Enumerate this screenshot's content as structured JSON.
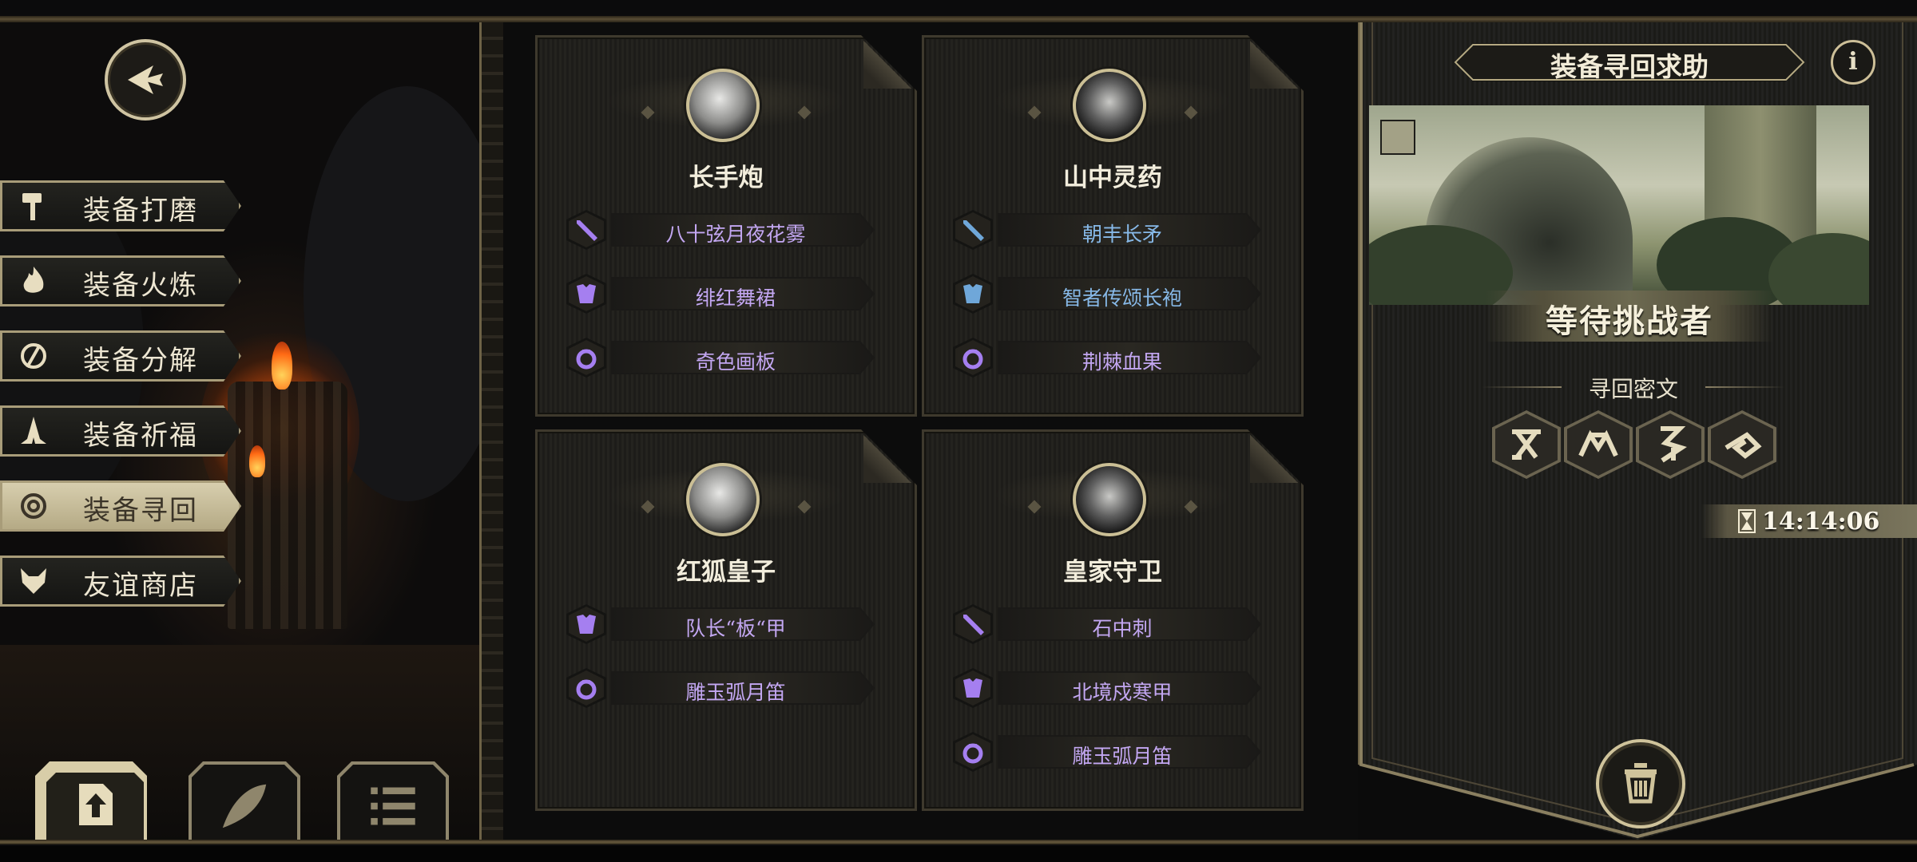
{
  "menu": {
    "items": [
      {
        "label": "装备打磨",
        "icon": "hammer-icon"
      },
      {
        "label": "装备火炼",
        "icon": "flame-icon"
      },
      {
        "label": "装备分解",
        "icon": "split-icon"
      },
      {
        "label": "装备祈福",
        "icon": "pray-hands-icon"
      },
      {
        "label": "装备寻回",
        "icon": "spiral-icon",
        "active": true
      },
      {
        "label": "友谊商店",
        "icon": "fox-icon"
      }
    ]
  },
  "cards": [
    {
      "name": "长手炮",
      "items": [
        {
          "label": "八十弦月夜花雾",
          "type": "sword-icon",
          "color": "purple"
        },
        {
          "label": "绯红舞裙",
          "type": "armor-icon",
          "color": "purple"
        },
        {
          "label": "奇色画板",
          "type": "ring-icon",
          "color": "purple"
        }
      ]
    },
    {
      "name": "山中灵药",
      "items": [
        {
          "label": "朝丰长矛",
          "type": "sword-icon",
          "color": "blue"
        },
        {
          "label": "智者传颂长袍",
          "type": "armor-icon",
          "color": "blue"
        },
        {
          "label": "荆棘血果",
          "type": "ring-icon",
          "color": "purple"
        }
      ]
    },
    {
      "name": "红狐皇子",
      "items": [
        {
          "label": "队长“板“甲",
          "type": "armor-icon",
          "color": "purple"
        },
        {
          "label": "雕玉弧月笛",
          "type": "ring-icon",
          "color": "purple"
        }
      ]
    },
    {
      "name": "皇家守卫",
      "items": [
        {
          "label": "石中刺",
          "type": "sword-icon",
          "color": "purple"
        },
        {
          "label": "北境戍寒甲",
          "type": "armor-icon",
          "color": "purple"
        },
        {
          "label": "雕玉弧月笛",
          "type": "ring-icon",
          "color": "purple"
        }
      ]
    }
  ],
  "panel": {
    "title": "装备寻回求助",
    "info": "i",
    "status": "等待挑战者",
    "cipher_label": "寻回密文",
    "timer": "14:14:06"
  },
  "colors": {
    "gold": "#cfc4a2",
    "purple_text": "#c3a7f2",
    "blue_text": "#87b9e8"
  }
}
